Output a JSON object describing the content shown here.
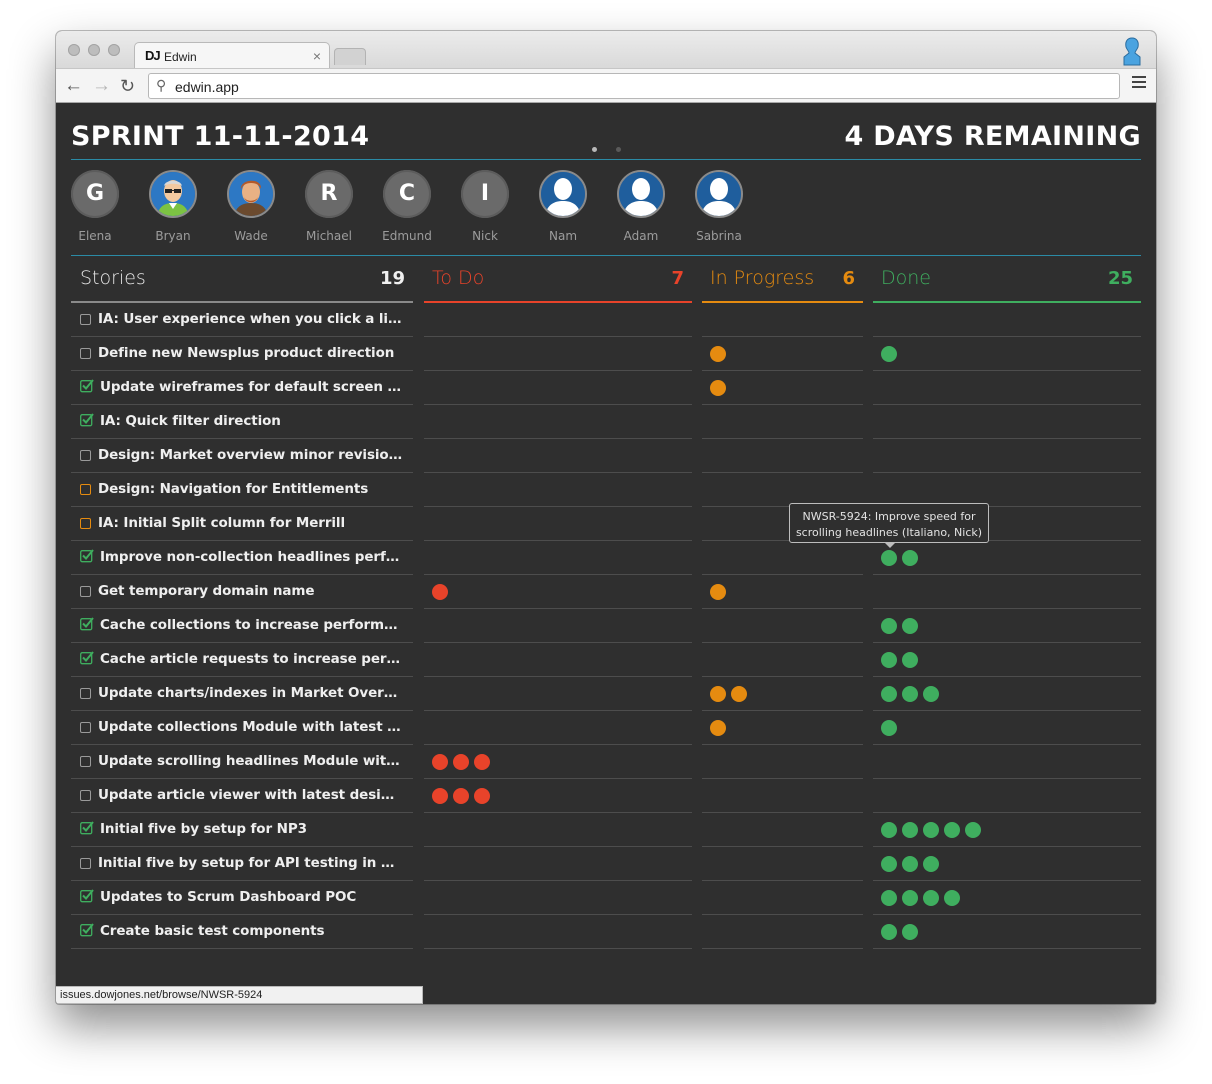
{
  "browser": {
    "tab_logo": "DJ",
    "tab_title": "Edwin",
    "tab_close": "×",
    "url": "edwin.app",
    "status_url": "issues.dowjones.net/browse/NWSR-5924"
  },
  "header": {
    "sprint_title": "SPRINT 11-11-2014",
    "days_remaining": "4 DAYS REMAINING"
  },
  "team": [
    {
      "name": "Elena",
      "initial": "G",
      "kind": "letter"
    },
    {
      "name": "Bryan",
      "initial": "",
      "kind": "photo-bryan"
    },
    {
      "name": "Wade",
      "initial": "",
      "kind": "photo-wade"
    },
    {
      "name": "Michael",
      "initial": "R",
      "kind": "letter"
    },
    {
      "name": "Edmund",
      "initial": "C",
      "kind": "letter"
    },
    {
      "name": "Nick",
      "initial": "I",
      "kind": "letter"
    },
    {
      "name": "Nam",
      "initial": "",
      "kind": "photo-default"
    },
    {
      "name": "Adam",
      "initial": "",
      "kind": "photo-default"
    },
    {
      "name": "Sabrina",
      "initial": "",
      "kind": "photo-default"
    }
  ],
  "columns": {
    "stories": {
      "label": "Stories",
      "count": "19"
    },
    "todo": {
      "label": "To Do",
      "count": "7",
      "color": "#e8432a"
    },
    "in_progress": {
      "label": "In Progress",
      "count": "6",
      "color": "#e58b10"
    },
    "done": {
      "label": "Done",
      "count": "25",
      "color": "#3fae5f"
    }
  },
  "stories": [
    {
      "title": "IA: User experience when you click a link to a...",
      "status": "empty",
      "todo": 0,
      "in_progress": 0,
      "done": 0
    },
    {
      "title": "Define new Newsplus product direction",
      "status": "empty",
      "todo": 0,
      "in_progress": 1,
      "done": 1
    },
    {
      "title": "Update wireframes for default screen and ad...",
      "status": "checked",
      "todo": 0,
      "in_progress": 1,
      "done": 0
    },
    {
      "title": "IA: Quick filter direction",
      "status": "checked",
      "todo": 0,
      "in_progress": 0,
      "done": 0
    },
    {
      "title": "Design: Market overview minor revisions",
      "status": "empty",
      "todo": 0,
      "in_progress": 0,
      "done": 0
    },
    {
      "title": "Design: Navigation for Entitlements",
      "status": "orange",
      "todo": 0,
      "in_progress": 0,
      "done": 0
    },
    {
      "title": "IA: Initial Split column for Merrill",
      "status": "orange",
      "todo": 0,
      "in_progress": 0,
      "done": 0
    },
    {
      "title": "Improve non-collection headlines performan...",
      "status": "checked",
      "todo": 0,
      "in_progress": 0,
      "done": 2
    },
    {
      "title": "Get temporary domain name",
      "status": "empty",
      "todo": 1,
      "in_progress": 1,
      "done": 0
    },
    {
      "title": "Cache collections to increase performance",
      "status": "checked",
      "todo": 0,
      "in_progress": 0,
      "done": 2
    },
    {
      "title": "Cache article requests to increase performance",
      "status": "checked",
      "todo": 0,
      "in_progress": 0,
      "done": 2
    },
    {
      "title": "Update charts/indexes in Market Overview M...",
      "status": "empty",
      "todo": 0,
      "in_progress": 2,
      "done": 3
    },
    {
      "title": "Update collections Module with latest designs",
      "status": "empty",
      "todo": 0,
      "in_progress": 1,
      "done": 1
    },
    {
      "title": "Update scrolling headlines Module with lates...",
      "status": "empty",
      "todo": 3,
      "in_progress": 0,
      "done": 0
    },
    {
      "title": "Update article viewer with latest designs",
      "status": "empty",
      "todo": 3,
      "in_progress": 0,
      "done": 0
    },
    {
      "title": "Initial five by setup for NP3",
      "status": "checked",
      "todo": 0,
      "in_progress": 0,
      "done": 5
    },
    {
      "title": "Initial five by setup for API testing in newsplu...",
      "status": "empty",
      "todo": 0,
      "in_progress": 0,
      "done": 3
    },
    {
      "title": "Updates to Scrum Dashboard POC",
      "status": "checked",
      "todo": 0,
      "in_progress": 0,
      "done": 4
    },
    {
      "title": "Create basic test components",
      "status": "checked",
      "todo": 0,
      "in_progress": 0,
      "done": 2
    }
  ],
  "tooltip": {
    "line1": "NWSR-5924: Improve speed for",
    "line2": "scrolling headlines (Italiano, Nick)"
  },
  "colors": {
    "accent_rule": "#2b8ba6",
    "background": "#2f2f2f",
    "check_green": "#3fae5f"
  }
}
